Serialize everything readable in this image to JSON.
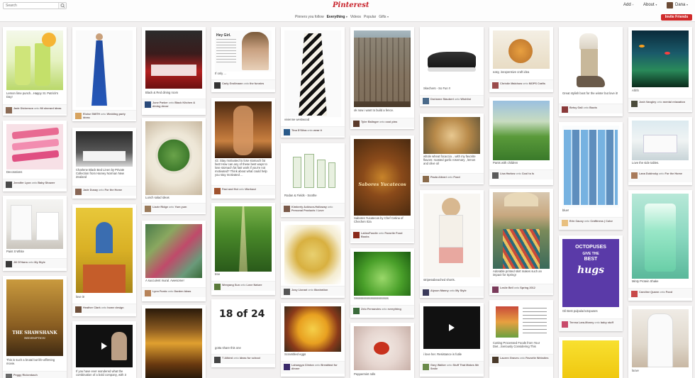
{
  "brand": "Pinterest",
  "search": {
    "placeholder": "Search"
  },
  "nav": {
    "add": "Add",
    "about": "About",
    "user": "Dana",
    "invite": "Invite Friends"
  },
  "categories": [
    "Pinners you follow",
    "Everything",
    "Videos",
    "Popular",
    "Gifts"
  ],
  "pins": [
    {
      "desc": "Lemon lime punch...Happy St. Patrick's Day!",
      "user": "Jade Dickerson",
      "board": "Mi sherard ideas"
    },
    {
      "desc": "Decorations",
      "user": "Jennifer Lyon",
      "board": "Baby Shower"
    },
    {
      "desc": "Paint It White",
      "user": "Jill D'Harra",
      "board": "My Style"
    },
    {
      "desc": "This is such a brutal but life-affirming movie.",
      "user": "Peggy Rickenbach",
      "board": ""
    },
    {
      "desc": "",
      "user": "Eloise SMITH",
      "board": "Wedding party ideas"
    },
    {
      "desc": "Charlene Black Bed Linen by Private Collection from Harvey Norman New Zealand",
      "user": "Jade Dusay",
      "board": "For the Home"
    },
    {
      "desc": "love it!",
      "user": "Heather Clark",
      "board": "home design"
    },
    {
      "desc": "If you have ever wondered what the combination of a bold company, with 3",
      "user": "",
      "board": ""
    },
    {
      "desc": "Black & Red dining room",
      "user": "June Parker",
      "board": "Black Kitchen & dining decor"
    },
    {
      "desc": "Lunch salad ideas",
      "user": "Lizzie Ridge",
      "board": "Yum yum"
    },
    {
      "desc": "A succulent mural. Awesome!",
      "user": "Lynn Fordo",
      "board": "Garden Ideas"
    },
    {
      "desc": "If only ...",
      "user": "Carly Grollmann",
      "board": "the funnies"
    },
    {
      "desc": "42. Stay motivated to lose stomach fat fast! How can any of these best ways to lose stomach fat fast work if you're not motivated? Think about what could help you stay motivated ...",
      "user": "",
      "board": ""
    },
    {
      "desc": "",
      "user": "Fast and Hot",
      "board": "Workout"
    },
    {
      "desc": "tree",
      "user": "Wenyang Sun",
      "board": "Love Nature"
    },
    {
      "desc": "gotta share this one",
      "user": "T Allbird",
      "board": "Ideas for school"
    },
    {
      "desc": "vivienne westwood",
      "user": "Tina D'Silva",
      "board": "wear it"
    },
    {
      "desc": "Rodan & Fields - Soothe",
      "user": "Kimberly Ackison-Holloway",
      "board": "Personal Products I Love"
    },
    {
      "desc": "",
      "user": "Josy Lionari",
      "board": "Illustration"
    },
    {
      "desc": "Scrambled eggs",
      "user": "Lahangya Clinton",
      "board": "Breakfast for dinner"
    },
    {
      "desc": "ok now i want to build a fence.",
      "user": "Tyler Balinger",
      "board": "cool pins"
    },
    {
      "desc": "Sabores Yucatecos by Chef Cetina of Chechen Itza",
      "user": "LatinoFoodie",
      "board": "Favorite Food Books"
    },
    {
      "desc": "Sssssssssssssssssssssss",
      "user": "Zelo Fernandes",
      "board": "everything"
    },
    {
      "desc": "Peppermint rolls",
      "user": "",
      "board": ""
    },
    {
      "desc": "Skechers - So Fun !!",
      "user": "Dorianne Staubert",
      "board": "Wishlist"
    },
    {
      "desc": "whole wheat focaccia ...with my favorite flavors: roasted garlic rosemary , lemon and olive oil",
      "user": "Paula Alteari",
      "board": "Food"
    },
    {
      "desc": "stripes&beached shorts.",
      "user": "Alyson Manny",
      "board": "My Style"
    },
    {
      "desc": "i love her. Resistance is futile",
      "user": "Gary Walker",
      "board": "Stuff That Makes Me Smile"
    },
    {
      "desc": "easy, inexpensive craft idea",
      "user": "Christie Malchow",
      "board": "MOPS Crafts"
    },
    {
      "desc": "Pants with children",
      "user": "Lisa Harlow",
      "board": "Cool to Is"
    },
    {
      "desc": "Adorable printed skirt makes such an impact for Spring!",
      "user": "Leslie Bell",
      "board": "Spring 2012"
    },
    {
      "desc": "Cutting Processed Foods from Your Diet...Seriously Considering This",
      "user": "Lauren Graves",
      "board": "Favorite Websites"
    },
    {
      "desc": "Great stylish boot for the winter but love it!",
      "user": "Betsy Gall",
      "board": "Boots"
    },
    {
      "desc": "blue!",
      "user": "Erin Causy",
      "board": "Craftiness | Color"
    },
    {
      "desc": "Oil Best pulpula/octopuses",
      "user": "Teresa Lara-Money",
      "board": "baby stuff"
    },
    {
      "desc": "Ahhh",
      "user": "Josh Vangley",
      "board": "mental relaxation"
    },
    {
      "desc": "Love the side tables.",
      "user": "Lana Dubinsky",
      "board": "For the Home"
    },
    {
      "desc": "Minty Protein Shake",
      "user": "Caroline Quann",
      "board": "Food"
    },
    {
      "desc": "loovv",
      "user": "",
      "board": ""
    }
  ],
  "overlays": {
    "poster_title": "THE SHAWSHANK",
    "poster_sub": "REDEMPTION",
    "quote_title": "Hey Girl.",
    "cookbook_title": "Sabores Yucatecos",
    "hugs_line1": "OCTOPUSES",
    "hugs_line2": "GIVE THE",
    "hugs_line3": "BEST",
    "hugs_line4": "hugs",
    "math_text": "18 of 24"
  },
  "colors": {
    "brand": "#c8232c",
    "invite": "#cf2b2b",
    "background": "#f2f0f0"
  }
}
